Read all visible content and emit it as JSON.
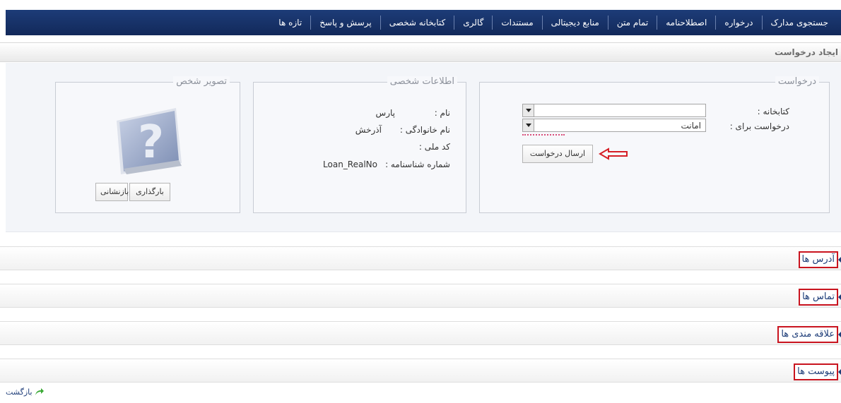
{
  "nav": {
    "items": [
      "جستجوی مدارک",
      "درخواره",
      "اصطلاحنامه",
      "تمام متن",
      "منابع دیجیتالی",
      "مستندات",
      "گالری",
      "کتابخانه شخصی",
      "پرسش و پاسخ",
      "تازه ها"
    ]
  },
  "page": {
    "title": "ایجاد درخواست"
  },
  "request": {
    "legend": "درخواست",
    "library_label": "کتابخانه :",
    "library_value": "",
    "request_for_label": "درخواست برای :",
    "request_for_value": "امانت",
    "submit_label": "ارسال درخواست"
  },
  "personal": {
    "legend": "اطلاعات شخصی",
    "name_label": "نام :",
    "name_value": "پارس",
    "family_label": "نام خانوادگی :",
    "family_value": "آذرخش",
    "national_label": "کد ملی :",
    "national_value": "",
    "id_label": "شماره شناسنامه :",
    "id_value": "Loan_RealNo"
  },
  "photo": {
    "legend": "تصویر شخص",
    "upload_label": "بارگذاری",
    "reset_label": "بازنشانی"
  },
  "sections": [
    "آدرس ها",
    "تماس ها",
    "علاقه مندی ها",
    "پیوست ها"
  ],
  "back_label": "بازگشت",
  "colors": {
    "nav": "#1d3c78",
    "highlight_box": "#c9141f",
    "arrow": "#d61f26",
    "back_arrow": "#3aa935"
  }
}
